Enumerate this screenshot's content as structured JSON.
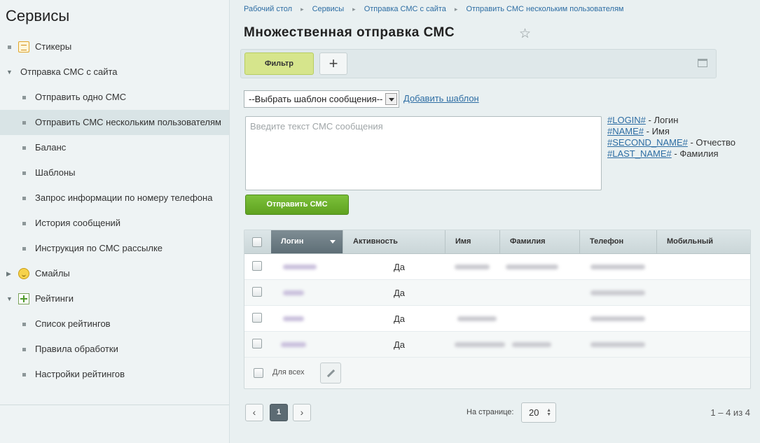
{
  "sidebar": {
    "title": "Сервисы",
    "items": [
      {
        "label": "Стикеры",
        "level": 1,
        "icon": "sticker-icon",
        "marker": "bullet"
      },
      {
        "label": "Отправка СМС с сайта",
        "level": 1,
        "marker": "arrow-down"
      },
      {
        "label": "Отправить одно СМС",
        "level": 2,
        "marker": "bullet"
      },
      {
        "label": "Отправить СМС нескольким пользователям",
        "level": 2,
        "marker": "bullet",
        "active": true
      },
      {
        "label": "Баланс",
        "level": 2,
        "marker": "bullet"
      },
      {
        "label": "Шаблоны",
        "level": 2,
        "marker": "bullet"
      },
      {
        "label": "Запрос информации по номеру телефона",
        "level": 2,
        "marker": "bullet"
      },
      {
        "label": "История сообщений",
        "level": 2,
        "marker": "bullet"
      },
      {
        "label": "Инструкция по СМС рассылке",
        "level": 2,
        "marker": "bullet"
      },
      {
        "label": "Смайлы",
        "level": 1,
        "icon": "smile-icon",
        "marker": "arrow-right"
      },
      {
        "label": "Рейтинги",
        "level": 1,
        "icon": "rating-icon",
        "marker": "arrow-down"
      },
      {
        "label": "Список рейтингов",
        "level": 2,
        "marker": "bullet"
      },
      {
        "label": "Правила обработки",
        "level": 2,
        "marker": "bullet"
      },
      {
        "label": "Настройки рейтингов",
        "level": 2,
        "marker": "bullet"
      }
    ]
  },
  "breadcrumb": [
    "Рабочий стол",
    "Сервисы",
    "Отправка СМС с сайта",
    "Отправить СМС нескольким пользователям"
  ],
  "page": {
    "title": "Множественная отправка СМС"
  },
  "filter": {
    "filter_label": "Фильтр",
    "add_label": "+"
  },
  "template": {
    "selected": "--Выбрать шаблон сообщения--",
    "add_link": "Добавить шаблон"
  },
  "message": {
    "placeholder": "Введите текст СМС сообщения",
    "send_label": "Отправить СМС"
  },
  "macros": [
    {
      "code": "#LOGIN#",
      "desc": " - Логин"
    },
    {
      "code": "#NAME#",
      "desc": " - Имя"
    },
    {
      "code": "#SECOND_NAME#",
      "desc": " - Отчество"
    },
    {
      "code": "#LAST_NAME#",
      "desc": " - Фамилия"
    }
  ],
  "grid": {
    "columns": [
      "Логин",
      "Активность",
      "Имя",
      "Фамилия",
      "Телефон",
      "Мобильный"
    ],
    "rows": [
      {
        "active": "Да"
      },
      {
        "active": "Да"
      },
      {
        "active": "Да"
      },
      {
        "active": "Да"
      }
    ],
    "footer_label": "Для всех"
  },
  "pager": {
    "prev": "‹",
    "current": "1",
    "next": "›",
    "per_page_label": "На странице:",
    "per_page": "20",
    "total": "1 – 4 из 4"
  },
  "colors": {
    "accent_green": "#6bb02a",
    "filter_green": "#d6e58c",
    "link": "#2d6da3",
    "sorted_header": "#6b7a82"
  }
}
